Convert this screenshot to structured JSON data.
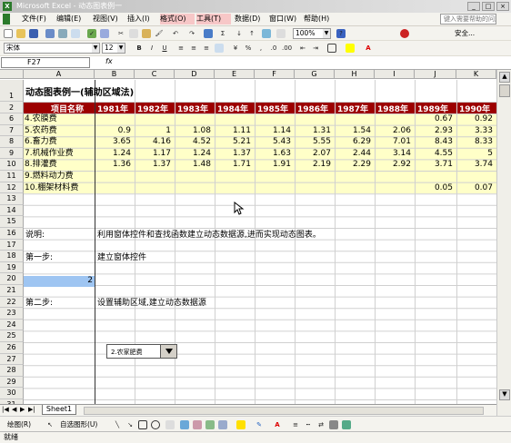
{
  "window": {
    "title": "Microsoft Excel - 动态图表例一",
    "help_placeholder": "键入需要帮助的问题"
  },
  "menu": [
    "文件(F)",
    "编辑(E)",
    "视图(V)",
    "插入(I)",
    "格式(O)",
    "工具(T)",
    "数据(D)",
    "窗口(W)",
    "帮助(H)"
  ],
  "toolbar": {
    "zoom": "100%",
    "security_label": "安全..."
  },
  "format_bar": {
    "font": "宋体",
    "size": "12",
    "bold": "B",
    "italic": "I",
    "underline": "U"
  },
  "formula_bar": {
    "cell_ref": "F27",
    "fx": "fx",
    "formula": ""
  },
  "columns": [
    "A",
    "B",
    "C",
    "D",
    "E",
    "F",
    "G",
    "H",
    "I",
    "J",
    "K"
  ],
  "rows": [
    "1",
    "2",
    "6",
    "7",
    "8",
    "9",
    "10",
    "11",
    "12",
    "13",
    "14",
    "15",
    "16",
    "17",
    "18",
    "19",
    "20",
    "21",
    "22",
    "23",
    "24",
    "25",
    "26",
    "27",
    "28",
    "29",
    "30",
    "31"
  ],
  "sheet": {
    "title": "动态图表例一(辅助区域法)",
    "header_label": "项目名称",
    "years": [
      "1981年",
      "1982年",
      "1983年",
      "1984年",
      "1985年",
      "1986年",
      "1987年",
      "1988年",
      "1989年",
      "1990年"
    ],
    "data_rows": [
      {
        "name": "4.农膜费",
        "values": [
          "",
          "",
          "",
          "",
          "",
          "",
          "",
          "",
          "0.67",
          "0.92"
        ]
      },
      {
        "name": "5.农药费",
        "values": [
          "0.9",
          "1",
          "1.08",
          "1.11",
          "1.14",
          "1.31",
          "1.54",
          "2.06",
          "2.93",
          "3.33"
        ]
      },
      {
        "name": "6.畜力费",
        "values": [
          "3.65",
          "4.16",
          "4.52",
          "5.21",
          "5.43",
          "5.55",
          "6.29",
          "7.01",
          "8.43",
          "8.33"
        ]
      },
      {
        "name": "7.机械作业费",
        "values": [
          "1.24",
          "1.17",
          "1.24",
          "1.37",
          "1.63",
          "2.07",
          "2.44",
          "3.14",
          "4.55",
          "5"
        ]
      },
      {
        "name": "8.排灌费",
        "values": [
          "1.36",
          "1.37",
          "1.48",
          "1.71",
          "1.91",
          "2.19",
          "2.29",
          "2.92",
          "3.71",
          "3.74"
        ]
      },
      {
        "name": "9.燃料动力费",
        "values": [
          "",
          "",
          "",
          "",
          "",
          "",
          "",
          "",
          "",
          ""
        ]
      },
      {
        "name": "10.棚架材料费",
        "values": [
          "",
          "",
          "",
          "",
          "",
          "",
          "",
          "",
          "0.05",
          "0.07"
        ]
      }
    ],
    "note_label": "说明:",
    "note_text": "利用窗体控件和查找函数建立动态数据源,进而实现动态图表。",
    "step1_label": "第一步:",
    "step1_text": "建立窗体控件",
    "a20_value": "2",
    "dropdown_value": "2.农家肥费",
    "step2_label": "第二步:",
    "step2_text": "设置辅助区域,建立动态数据源"
  },
  "sheet_tab": "Sheet1",
  "drawing_bar": {
    "draw_label": "绘图(R)",
    "autoshape_label": "自选图形(U)"
  },
  "status": "就绪",
  "colors": {
    "header_bg": "#9c0000",
    "data_bg": "#ffffc8",
    "selected": "#9ec5f2"
  }
}
